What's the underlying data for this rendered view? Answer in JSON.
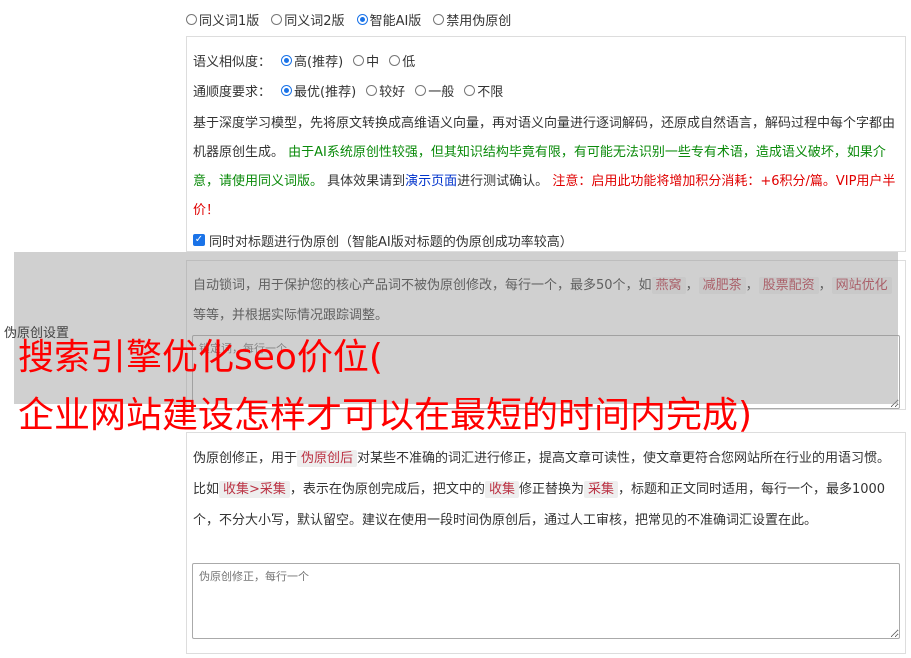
{
  "mode": {
    "options": [
      "同义词1版",
      "同义词2版",
      "智能AI版",
      "禁用伪原创"
    ],
    "selected": "智能AI版"
  },
  "similarity": {
    "label": "语义相似度：",
    "options": [
      "高(推荐)",
      "中",
      "低"
    ],
    "selected": "高(推荐)"
  },
  "fluency": {
    "label": "通顺度要求：",
    "options": [
      "最优(推荐)",
      "较好",
      "一般",
      "不限"
    ],
    "selected": "最优(推荐)"
  },
  "description": {
    "part1": "基于深度学习模型，先将原文转换成高维语义向量，再对语义向量进行逐词解码，还原成自然语言，解码过程中每个字都由机器原创生成。 ",
    "warn_green": "由于AI系统原创性较强，但其知识结构毕竟有限，有可能无法识别一些专有术语，造成语义破坏，如果介意，请使用同义词版。",
    "part2": " 具体效果请到",
    "link": "演示页面",
    "part3": "进行测试确认。 ",
    "warn_red": "注意：启用此功能将增加积分消耗：+6积分/篇。VIP用户半价！"
  },
  "title_checkbox": {
    "label": "同时对标题进行伪原创（智能AI版对标题的伪原创成功率较高）",
    "checked": true
  },
  "side_label": "伪原创设置",
  "lock_words": {
    "desc_a": "自动锁词，用于保护您的核心产品词不被伪原创修改，每行一个，最多50个，如",
    "examples": [
      "燕窝",
      "减肥茶",
      "股票配资",
      "网站优化"
    ],
    "desc_b": "等等，并根据实际情况跟踪调整。",
    "placeholder": "锁定词，每行一个"
  },
  "headline": {
    "line1": "搜索引擎优化seo价位(",
    "line2": "企业网站建设怎样才可以在最短的时间内完成)"
  },
  "correction": {
    "desc_a": "伪原创修正，用于",
    "tag_after": "伪原创后",
    "desc_b": "对某些不准确的词汇进行修正，提高文章可读性，使文章更符合您网站所在行业的用语习惯。比如",
    "example": "收集>采集",
    "desc_c": "，表示在伪原创完成后，把文中的",
    "from": "收集",
    "desc_d": "修正替换为",
    "to": "采集",
    "desc_e": "，标题和正文同时适用，每行一个，最多1000个，不分大小写，默认留空。建议在使用一段时间伪原创后，通过人工审核，把常见的不准确词汇设置在此。",
    "placeholder": "伪原创修正，每行一个"
  },
  "colors": {
    "accent": "#1a73e8",
    "green": "#0a8a0a",
    "red": "#e00000",
    "link": "#0033cc",
    "headline": "#ff0000"
  }
}
